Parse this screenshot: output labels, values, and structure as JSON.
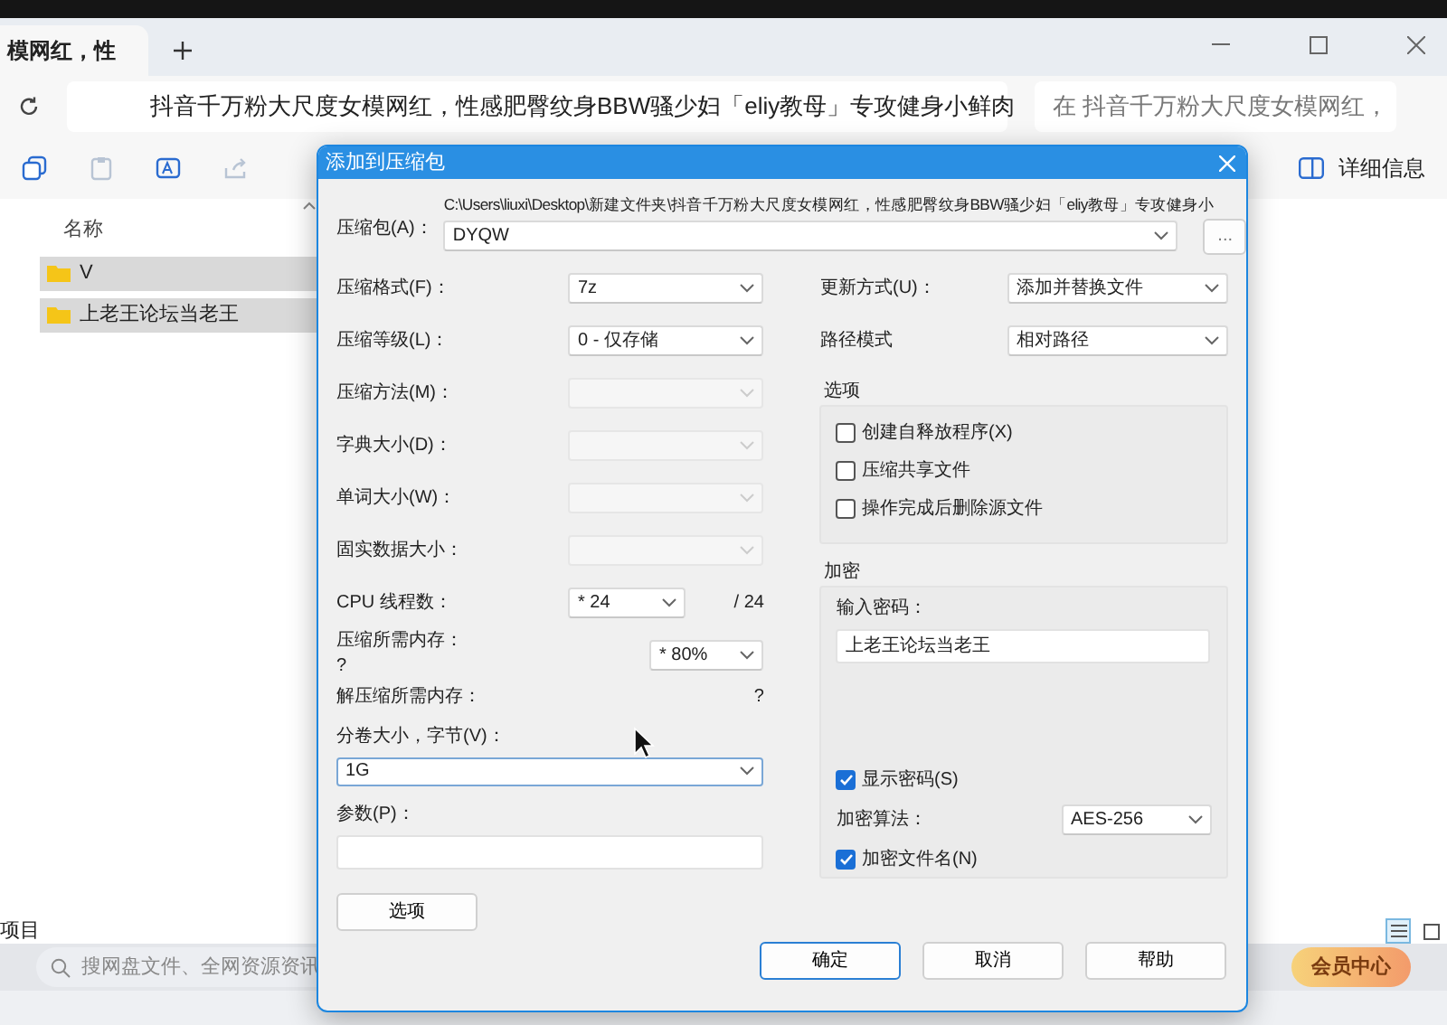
{
  "explorer": {
    "tab_title": "模网红，性",
    "path": "抖音千万粉大尺度女模网红，性感肥臀纹身BBW骚少妇「eliy教母」专攻健身小鲜肉",
    "search_placeholder": "在 抖音千万粉大尺度女模网红，",
    "details_label": "详细信息",
    "column_header": "名称",
    "files": [
      {
        "name": "V",
        "selected": true
      },
      {
        "name": "上老王论坛当老王",
        "selected": true
      }
    ],
    "status": "项目",
    "views": [
      {
        "selected": true
      },
      {
        "selected": false
      }
    ],
    "cloud_search_placeholder": "搜网盘文件、全网资源资讯",
    "vip_label": "会员中心"
  },
  "dialog": {
    "title": "添加到压缩包",
    "archive": {
      "label": "压缩包(A)：",
      "path": "C:\\Users\\liuxi\\Desktop\\新建文件夹\\抖音千万粉大尺度女模网红，性感肥臀纹身BBW骚少妇「eliy教母」专攻健身小",
      "name": "DYQW",
      "browse": "..."
    },
    "left": [
      {
        "kind": "select",
        "label": "压缩格式(F)：",
        "value": "7z",
        "disabled": false
      },
      {
        "kind": "select",
        "label": "压缩等级(L)：",
        "value": "0 - 仅存储",
        "disabled": false
      },
      {
        "kind": "select",
        "label": "压缩方法(M)：",
        "disabled": true
      },
      {
        "kind": "select",
        "label": "字典大小(D)：",
        "disabled": true
      },
      {
        "kind": "select",
        "label": "单词大小(W)：",
        "disabled": true
      },
      {
        "kind": "select",
        "label": "固实数据大小：",
        "disabled": true
      },
      {
        "kind": "threads",
        "label": "CPU 线程数：",
        "value": "* 24",
        "note": "/ 24"
      },
      {
        "kind": "memory",
        "label": "压缩所需内存：",
        "note": "?",
        "value": "* 80%"
      },
      {
        "kind": "info",
        "label": "解压缩所需内存：",
        "note": "?"
      },
      {
        "kind": "wide_select",
        "label": "分卷大小，字节(V)：",
        "value": "1G"
      },
      {
        "kind": "input",
        "label": "参数(P)："
      }
    ],
    "options_button": "选项",
    "right": [
      {
        "label": "更新方式(U)：",
        "value": "添加并替换文件"
      },
      {
        "label": "路径模式",
        "value": "相对路径"
      }
    ],
    "options_group": {
      "title": "选项",
      "checks": [
        {
          "label": "创建自释放程序(X)",
          "checked": false
        },
        {
          "label": "压缩共享文件",
          "checked": false
        },
        {
          "label": "操作完成后删除源文件",
          "checked": false
        }
      ]
    },
    "encryption": {
      "title": "加密",
      "password_label": "输入密码：",
      "password": "上老王论坛当老王",
      "show_password": {
        "label": "显示密码(S)",
        "checked": true
      },
      "method_label": "加密算法：",
      "method": "AES-256",
      "encrypt_names": {
        "label": "加密文件名(N)",
        "checked": true
      }
    },
    "buttons": [
      {
        "label": "确定",
        "default": true
      },
      {
        "label": "取消",
        "default": false
      },
      {
        "label": "帮助",
        "default": false
      }
    ]
  }
}
